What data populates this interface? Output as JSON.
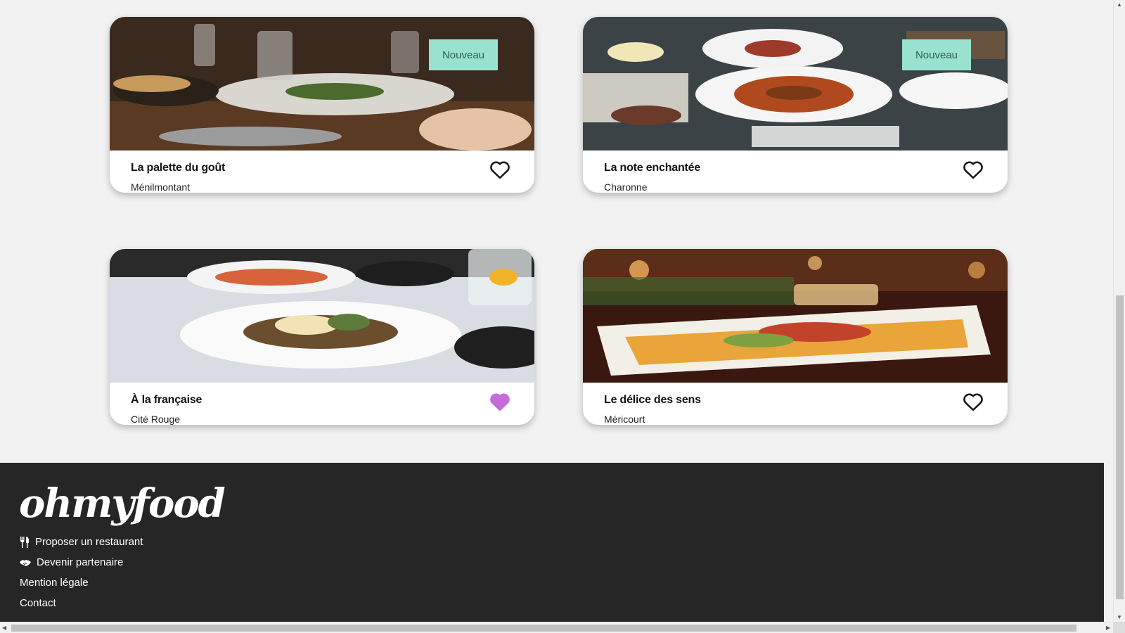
{
  "colors": {
    "badge_bg": "#99e2d0",
    "badge_text": "#2e6052",
    "heart_liked": "#c56bda",
    "footer_bg": "#262626",
    "page_bg": "#f2f2f2"
  },
  "restaurants": [
    {
      "name": "La palette du goût",
      "area": "Ménilmontant",
      "badge": "Nouveau",
      "liked": false
    },
    {
      "name": "La note enchantée",
      "area": "Charonne",
      "badge": "Nouveau",
      "liked": false
    },
    {
      "name": "À la française",
      "area": "Cité Rouge",
      "badge": "",
      "liked": true
    },
    {
      "name": "Le délice des sens",
      "area": "Méricourt",
      "badge": "",
      "liked": false
    }
  ],
  "footer": {
    "logo": "ohmyfood",
    "links": [
      {
        "label": "Proposer un restaurant",
        "icon": "utensils-icon"
      },
      {
        "label": "Devenir partenaire",
        "icon": "handshake-icon"
      },
      {
        "label": "Mention légale",
        "icon": ""
      },
      {
        "label": "Contact",
        "icon": ""
      }
    ]
  }
}
